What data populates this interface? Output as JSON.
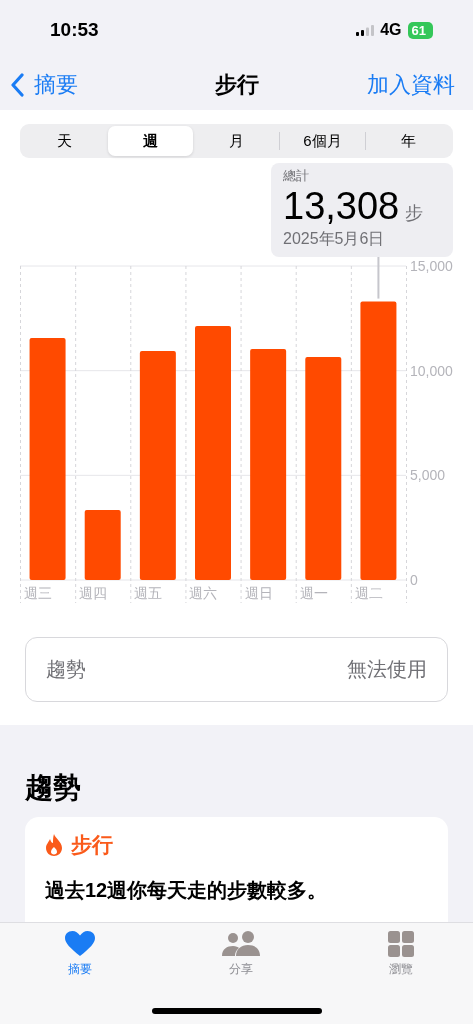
{
  "status_bar": {
    "time": "10:53",
    "network": "4G",
    "battery": "61"
  },
  "nav": {
    "back": "摘要",
    "title": "步行",
    "action": "加入資料"
  },
  "segments": [
    {
      "label": "天",
      "selected": false
    },
    {
      "label": "週",
      "selected": true
    },
    {
      "label": "月",
      "selected": false
    },
    {
      "label": "6個月",
      "selected": false
    },
    {
      "label": "年",
      "selected": false
    }
  ],
  "tooltip": {
    "label": "總計",
    "value": "13,308",
    "unit": "步",
    "date": "2025年5月6日"
  },
  "chart_data": {
    "type": "bar",
    "categories": [
      "週三",
      "週四",
      "週五",
      "週六",
      "週日",
      "週一",
      "週二"
    ],
    "values": [
      11560,
      3340,
      10940,
      12130,
      11030,
      10650,
      13300
    ],
    "ylim": [
      0,
      15000
    ],
    "yticks": [
      {
        "value": 0,
        "label": "0"
      },
      {
        "value": 5000,
        "label": "5,000"
      },
      {
        "value": 10000,
        "label": "10,000"
      },
      {
        "value": 15000,
        "label": "15,000"
      }
    ],
    "annotations": [
      {
        "x": "週二"
      }
    ]
  },
  "trend_row": {
    "label": "趨勢",
    "value": "無法使用"
  },
  "trends_section": {
    "heading": "趨勢",
    "card": {
      "title": "步行",
      "text": "過去12週你每天走的步數較多。"
    }
  },
  "tab_bar": [
    {
      "label": "摘要",
      "selected": true
    },
    {
      "label": "分享",
      "selected": false
    },
    {
      "label": "瀏覽",
      "selected": false
    }
  ]
}
